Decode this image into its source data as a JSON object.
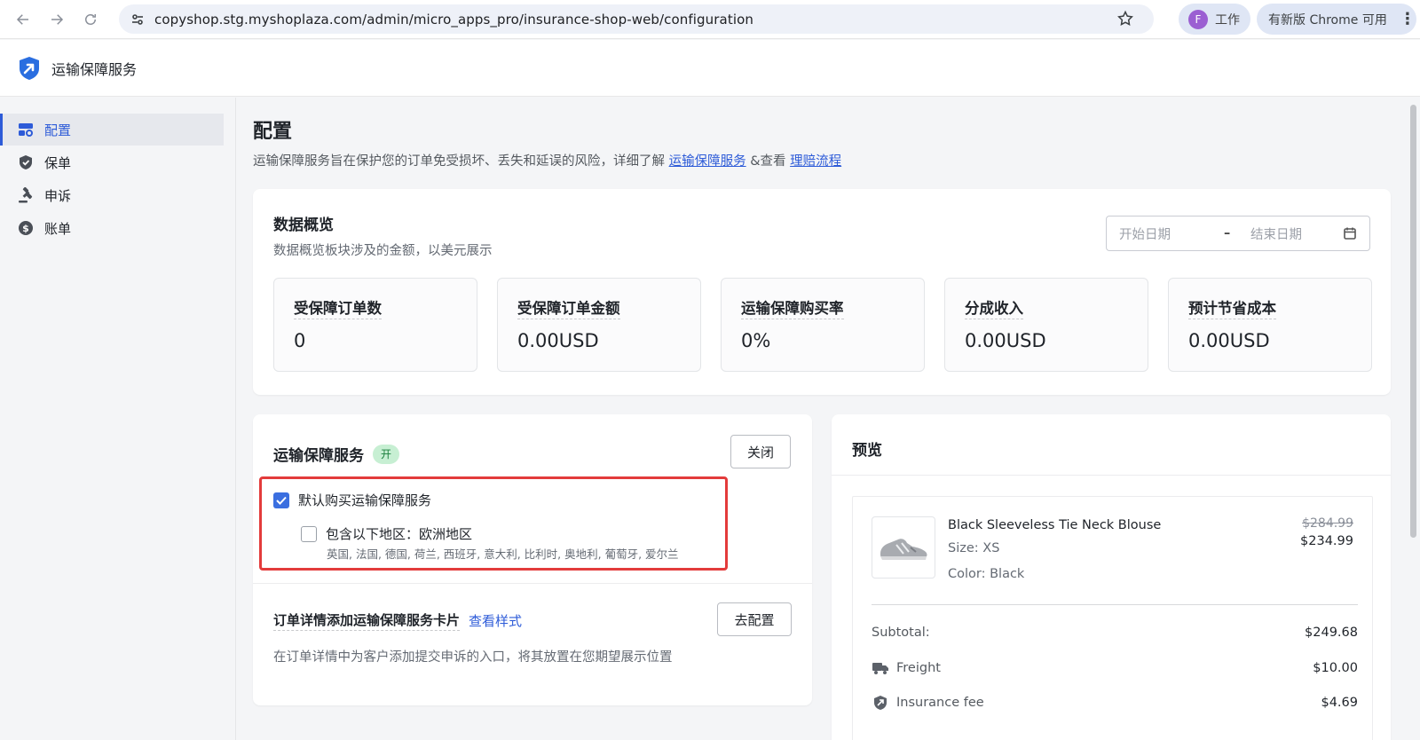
{
  "browser": {
    "url": "copyshop.stg.myshoplaza.com/admin/micro_apps_pro/insurance-shop-web/configuration",
    "profile_initial": "F",
    "profile_label": "工作",
    "update_label": "有新版 Chrome 可用"
  },
  "app": {
    "title": "运输保障服务"
  },
  "sidebar": {
    "items": [
      {
        "label": "配置",
        "icon": "config-icon",
        "active": true
      },
      {
        "label": "保单",
        "icon": "shield-icon",
        "active": false
      },
      {
        "label": "申诉",
        "icon": "gavel-icon",
        "active": false
      },
      {
        "label": "账单",
        "icon": "dollar-icon",
        "active": false
      }
    ]
  },
  "page": {
    "title": "配置",
    "desc_prefix": "运输保障服务旨在保护您的订单免受损坏、丢失和延误的风险，详细了解",
    "desc_link1": "运输保障服务",
    "desc_mid": "&查看",
    "desc_link2": "理赔流程"
  },
  "overview": {
    "title": "数据概览",
    "subtitle": "数据概览板块涉及的金额，以美元展示",
    "start_placeholder": "开始日期",
    "end_placeholder": "结束日期",
    "stats": [
      {
        "label": "受保障订单数",
        "value": "0"
      },
      {
        "label": "受保障订单金额",
        "value": "0.00USD"
      },
      {
        "label": "运输保障购买率",
        "value": "0%"
      },
      {
        "label": "分成收入",
        "value": "0.00USD"
      },
      {
        "label": "预计节省成本",
        "value": "0.00USD"
      }
    ]
  },
  "service": {
    "title": "运输保障服务",
    "status_badge": "开",
    "close_label": "关闭",
    "default_buy_label": "默认购买运输保障服务",
    "default_buy_checked": true,
    "include_region_label": "包含以下地区：欧洲地区",
    "include_region_checked": false,
    "countries": "英国, 法国, 德国, 荷兰, 西班牙, 意大利, 比利时, 奥地利, 葡萄牙, 爱尔兰",
    "card_title": "订单详情添加运输保障服务卡片",
    "view_style_link": "查看样式",
    "config_label": "去配置",
    "card_desc": "在订单详情中为客户添加提交申诉的入口，将其放置在您期望展示位置"
  },
  "preview": {
    "title": "预览",
    "product_name": "Black Sleeveless Tie Neck Blouse",
    "size": "Size: XS",
    "color": "Color: Black",
    "price_original": "$284.99",
    "price_sale": "$234.99",
    "subtotal_label": "Subtotal:",
    "subtotal_value": "$249.68",
    "freight_label": "Freight",
    "freight_value": "$10.00",
    "insurance_label": "Insurance fee",
    "insurance_value": "$4.69"
  },
  "colors": {
    "accent": "#2d5bd8",
    "highlight_border": "#e33b3b",
    "badge_bg": "#c7efd3",
    "badge_text": "#1a7f3c"
  }
}
